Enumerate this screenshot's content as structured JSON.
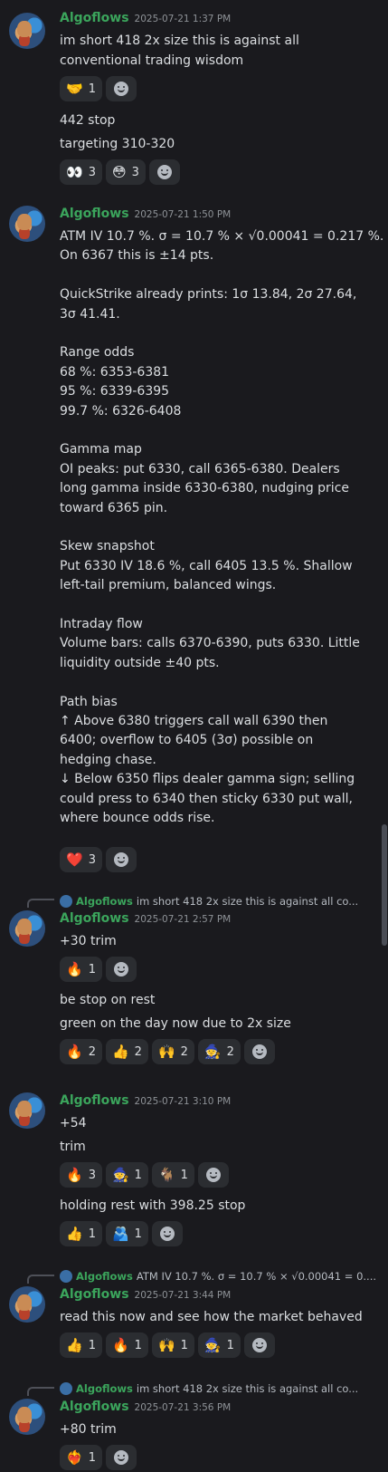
{
  "messages": [
    {
      "username": "Algoflows",
      "timestamp": "2025-07-21 1:37 PM",
      "lines": [
        "im short 418 2x size this is against all",
        "conventional trading wisdom"
      ],
      "reactions1": [
        {
          "emoji": "🤝",
          "count": "1"
        }
      ],
      "followups": [
        "442 stop",
        "targeting 310-320"
      ],
      "reactions2": [
        {
          "emoji": "👀",
          "count": "3"
        },
        {
          "emoji": "😳",
          "count": "3"
        }
      ]
    },
    {
      "username": "Algoflows",
      "timestamp": "2025-07-21 1:50 PM",
      "lines": [
        "ATM IV 10.7 %. σ = 10.7 % × √0.00041 = 0.217 %.",
        "On 6367 this is ±14 pts.",
        "",
        "QuickStrike already prints: 1σ 13.84, 2σ 27.64,",
        "3σ 41.41.",
        "",
        "Range odds",
        "68 %: 6353-6381",
        "95 %: 6339-6395",
        "99.7 %: 6326-6408",
        "",
        "Gamma map",
        "OI peaks: put 6330, call 6365-6380. Dealers",
        "long gamma inside 6330-6380, nudging price",
        "toward 6365 pin.",
        "",
        "Skew snapshot",
        "Put 6330 IV 18.6 %, call 6405 13.5 %. Shallow",
        "left-tail premium, balanced wings.",
        "",
        "Intraday flow",
        "Volume bars: calls 6370-6390, puts 6330. Little",
        "liquidity outside ±40 pts.",
        "",
        "Path bias",
        "↑ Above 6380 triggers call wall 6390 then",
        "6400; overflow to 6405 (3σ) possible on",
        "hedging chase.",
        "↓ Below 6350 flips dealer gamma sign; selling",
        "could press to 6340 then sticky 6330 put wall,",
        "where bounce odds rise."
      ],
      "reactions": [
        {
          "emoji": "❤️",
          "count": "3"
        }
      ]
    },
    {
      "reply": {
        "username": "Algoflows",
        "text": "im short 418 2x size this is against all co..."
      },
      "username": "Algoflows",
      "timestamp": "2025-07-21 2:57 PM",
      "lines": [
        "+30 trim"
      ],
      "reactions1": [
        {
          "emoji": "🔥",
          "count": "1"
        }
      ],
      "followups": [
        "be stop on rest",
        "green on the day now due to 2x size"
      ],
      "reactions2": [
        {
          "emoji": "🔥",
          "count": "2"
        },
        {
          "emoji": "👍",
          "count": "2"
        },
        {
          "emoji": "🙌",
          "count": "2"
        },
        {
          "emoji": "🧙",
          "count": "2"
        }
      ]
    },
    {
      "username": "Algoflows",
      "timestamp": "2025-07-21 3:10 PM",
      "lines": [
        "+54"
      ],
      "followups": [
        "trim"
      ],
      "reactions1": [
        {
          "emoji": "🔥",
          "count": "3"
        },
        {
          "emoji": "🧙",
          "count": "1"
        },
        {
          "emoji": "🐐",
          "count": "1"
        }
      ],
      "followups2": [
        "holding rest with 398.25 stop"
      ],
      "reactions2": [
        {
          "emoji": "👍",
          "count": "1"
        },
        {
          "emoji": "🫂",
          "count": "1"
        }
      ]
    },
    {
      "reply": {
        "username": "Algoflows",
        "text": "ATM IV 10.7 %. σ = 10.7 % × √0.00041 = 0...."
      },
      "username": "Algoflows",
      "timestamp": "2025-07-21 3:44 PM",
      "lines": [
        "read this now and see how the market behaved"
      ],
      "reactions": [
        {
          "emoji": "👍",
          "count": "1"
        },
        {
          "emoji": "🔥",
          "count": "1"
        },
        {
          "emoji": "🙌",
          "count": "1"
        },
        {
          "emoji": "🧙",
          "count": "1"
        }
      ]
    },
    {
      "reply": {
        "username": "Algoflows",
        "text": "im short 418 2x size this is against all co..."
      },
      "username": "Algoflows",
      "timestamp": "2025-07-21 3:56 PM",
      "lines": [
        "+80 trim"
      ],
      "reactions": [
        {
          "emoji": "❤️‍🔥",
          "count": "1"
        }
      ]
    }
  ]
}
